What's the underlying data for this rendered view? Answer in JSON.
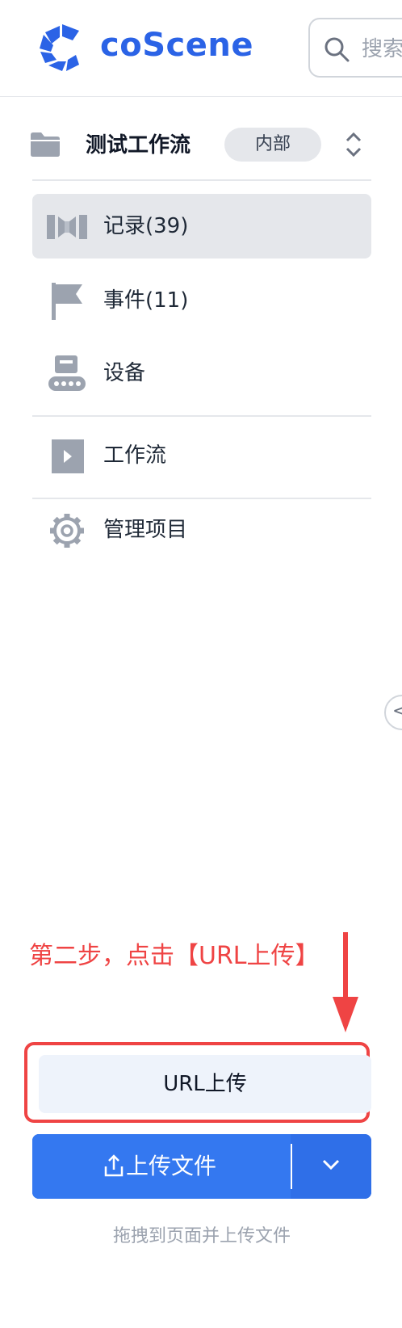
{
  "header": {
    "brand": "coScene",
    "search_placeholder": "搜索"
  },
  "project": {
    "title": "测试工作流",
    "badge": "内部"
  },
  "nav": {
    "records": "记录(39)",
    "events": "事件(11)",
    "devices": "设备",
    "workflows": "工作流",
    "manage": "管理项目"
  },
  "annotation": {
    "text": "第二步，点击【URL上传】"
  },
  "actions": {
    "url_upload": "URL上传",
    "upload_file": "上传文件",
    "drag_hint": "拖拽到页面并上传文件"
  },
  "colors": {
    "brand": "#2b63e6",
    "primary_button": "#3478f0",
    "annotation": "#ef4444",
    "active_nav_bg": "#e5e7eb"
  }
}
